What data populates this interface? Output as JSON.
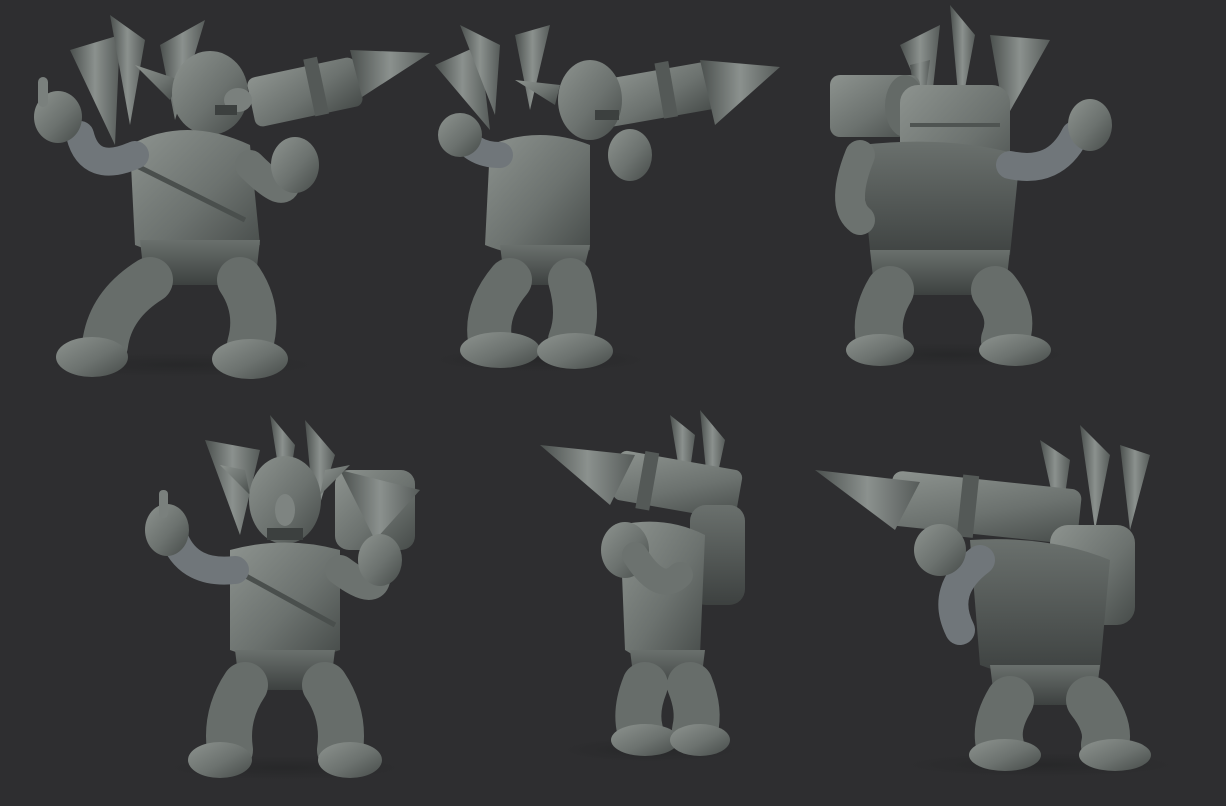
{
  "background_color": "#2e2e30",
  "clay_colors": {
    "base": "#6c726f",
    "light": "#8a918d",
    "dark": "#474c4a",
    "shadow": "#383c3b"
  },
  "views": [
    {
      "name": "front-three-quarter-left"
    },
    {
      "name": "side-profile-right"
    },
    {
      "name": "back-view"
    },
    {
      "name": "front-view"
    },
    {
      "name": "side-profile-left"
    },
    {
      "name": "back-three-quarter-left"
    }
  ]
}
